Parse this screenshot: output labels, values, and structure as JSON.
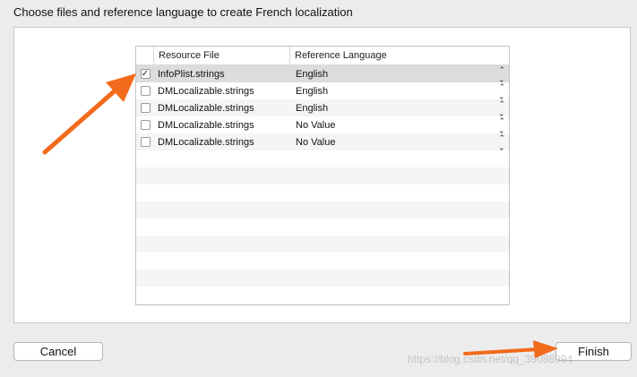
{
  "dialog": {
    "prompt": "Choose files and reference language to create French localization"
  },
  "table": {
    "columns": [
      "Resource File",
      "Reference Language"
    ],
    "rows": [
      {
        "checked": true,
        "file": "InfoPlist.strings",
        "language": "English",
        "selected": true
      },
      {
        "checked": false,
        "file": "DMLocalizable.strings",
        "language": "English",
        "selected": false
      },
      {
        "checked": false,
        "file": "DMLocalizable.strings",
        "language": "English",
        "selected": false
      },
      {
        "checked": false,
        "file": "DMLocalizable.strings",
        "language": "No Value",
        "selected": false
      },
      {
        "checked": false,
        "file": "DMLocalizable.strings",
        "language": "No Value",
        "selected": false
      }
    ]
  },
  "buttons": {
    "cancel": "Cancel",
    "finish": "Finish"
  },
  "watermark": "https://blog.csdn.net/qq_39086994",
  "icons": {
    "checkmark": "checkmark-icon",
    "stepper": "up-down-chevron-icon",
    "annotation": "orange-arrow-icon"
  },
  "colors": {
    "accent_arrow": "#f26a1b",
    "selected_row": "#dcdcdc"
  }
}
